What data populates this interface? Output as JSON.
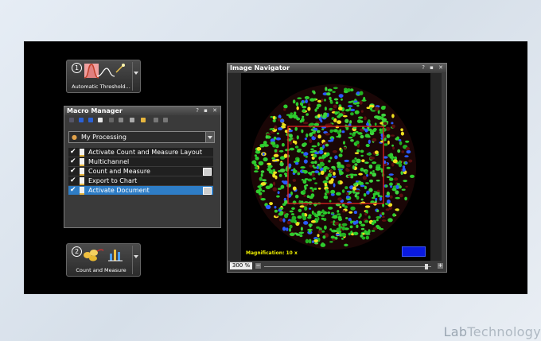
{
  "tools": {
    "threshold": {
      "number": "1",
      "label": "Automatic Threshold..."
    },
    "count": {
      "number": "2",
      "label": "Count and Measure"
    }
  },
  "macro_manager": {
    "title": "Macro Manager",
    "window_controls": "? ▪ ✕",
    "selected_set": "My Processing",
    "items": [
      {
        "label": "Activate Count and Measure Layout",
        "checked": true,
        "popout": false,
        "selected": false
      },
      {
        "label": "Multichannel",
        "checked": true,
        "popout": false,
        "selected": false
      },
      {
        "label": "Count and Measure",
        "checked": true,
        "popout": true,
        "selected": false
      },
      {
        "label": "Export to Chart",
        "checked": true,
        "popout": false,
        "selected": false
      },
      {
        "label": "Activate Document",
        "checked": true,
        "popout": true,
        "selected": true
      }
    ]
  },
  "image_navigator": {
    "title": "Image Navigator",
    "window_controls": "? ▪ ✕",
    "magnification_text": "Magnification:  10 x",
    "zoom_value": "300 %",
    "zoom_minus": "−",
    "zoom_plus": "+",
    "zoom_slider_fraction": 0.97
  },
  "watermark": {
    "part1": "Lab",
    "part2": "Technology"
  },
  "colors": {
    "stage": "#000000",
    "selection": "#2e7dc6",
    "cells_green": "#2ecc2e",
    "cells_yellow": "#f0e020",
    "cells_blue": "#2a5cff",
    "roi_red": "#d02020",
    "magnification_text": "#f0f000"
  },
  "icons": [
    "histogram-icon",
    "wand-icon",
    "dots-icon",
    "bar-chart-icon",
    "user-icon",
    "doc-icon",
    "check-icon"
  ]
}
